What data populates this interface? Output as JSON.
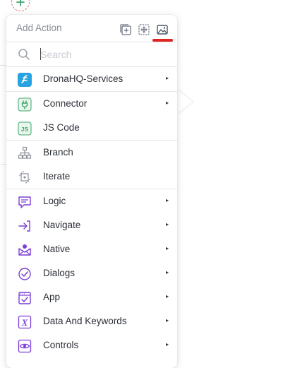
{
  "header": {
    "title": "Add Action",
    "icons": [
      "add-box-icon",
      "move-icon",
      "image-icon"
    ]
  },
  "search": {
    "placeholder": "Search",
    "value": ""
  },
  "groups": [
    [
      {
        "label": "DronaHQ-Services",
        "icon": "dronahq-icon",
        "submenu": true
      }
    ],
    [
      {
        "label": "Connector",
        "icon": "plug-icon",
        "submenu": true
      },
      {
        "label": "JS Code",
        "icon": "js-icon",
        "submenu": false
      }
    ],
    [
      {
        "label": "Branch",
        "icon": "branch-icon",
        "submenu": false
      },
      {
        "label": "Iterate",
        "icon": "iterate-icon",
        "submenu": false
      }
    ],
    [
      {
        "label": "Logic",
        "icon": "logic-icon",
        "submenu": true
      },
      {
        "label": "Navigate",
        "icon": "navigate-icon",
        "submenu": true
      },
      {
        "label": "Native",
        "icon": "native-icon",
        "submenu": true
      },
      {
        "label": "Dialogs",
        "icon": "dialogs-icon",
        "submenu": true
      },
      {
        "label": "App",
        "icon": "app-icon",
        "submenu": true
      },
      {
        "label": "Data And Keywords",
        "icon": "variable-icon",
        "submenu": true
      },
      {
        "label": "Controls",
        "icon": "eye-icon",
        "submenu": true
      }
    ]
  ],
  "arrow_glyph": "▸",
  "colors": {
    "accent_purple": "#7b3fd6",
    "accent_green": "#3fa66a",
    "accent_blue": "#29a3e0",
    "underline_red": "#e02424"
  }
}
